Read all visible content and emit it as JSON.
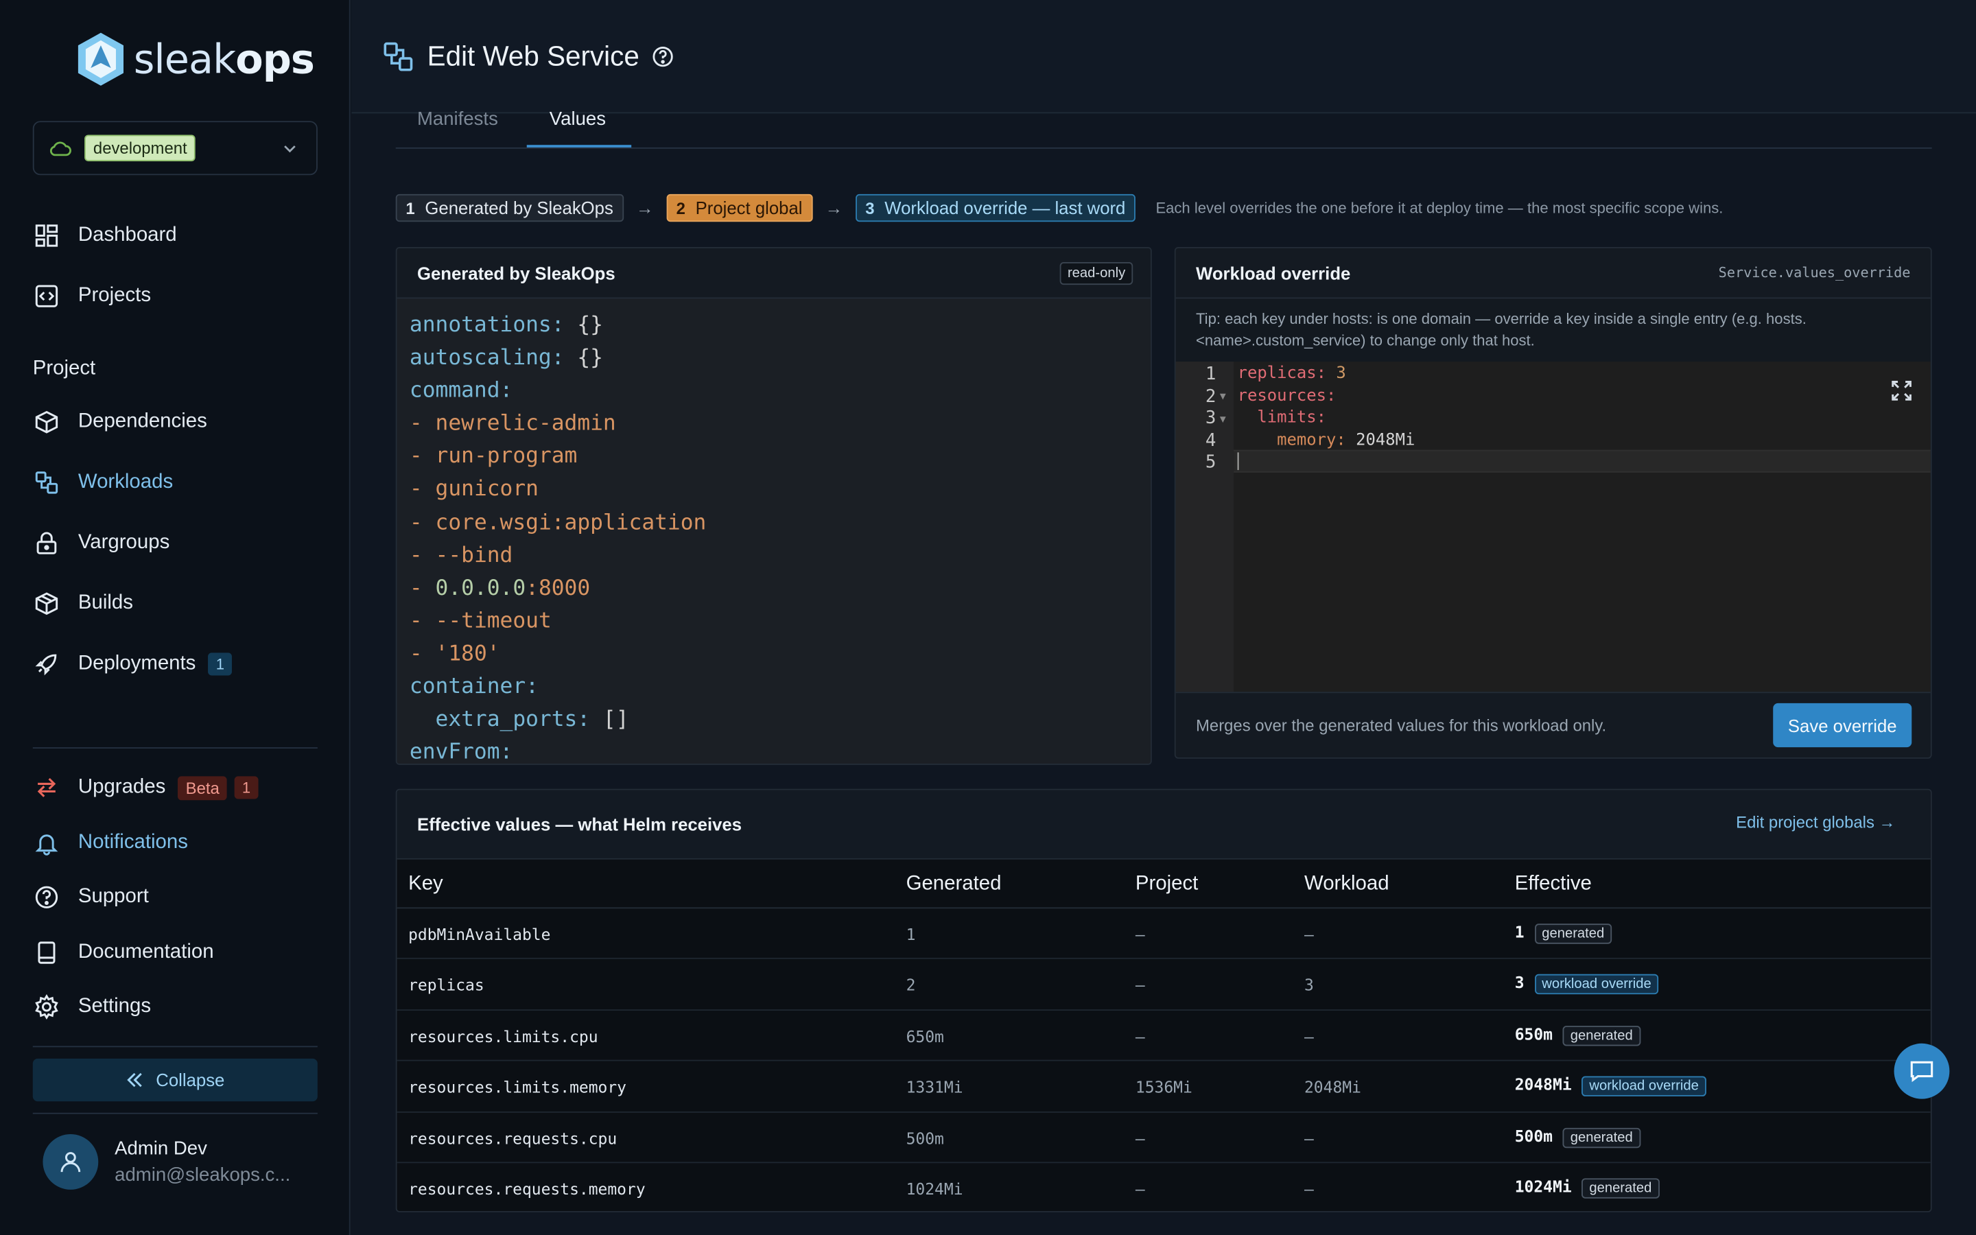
{
  "brand": {
    "name_light": "sleak",
    "name_bold": "ops"
  },
  "environment": {
    "selected": "development"
  },
  "nav": {
    "dashboard": "Dashboard",
    "projects": "Projects",
    "section_project": "Project",
    "dependencies": "Dependencies",
    "workloads": "Workloads",
    "vargroups": "Vargroups",
    "builds": "Builds",
    "deployments": "Deployments",
    "deployments_count": "1",
    "upgrades": "Upgrades",
    "upgrades_beta": "Beta",
    "upgrades_count": "1",
    "notifications": "Notifications",
    "support": "Support",
    "documentation": "Documentation",
    "settings": "Settings",
    "collapse": "Collapse"
  },
  "user": {
    "name": "Admin Dev",
    "email": "admin@sleakops.c..."
  },
  "header": {
    "title": "Edit Web Service"
  },
  "tabs": {
    "manifests": "Manifests",
    "values": "Values"
  },
  "chain": {
    "step1_num": "1",
    "step1": "Generated by SleakOps",
    "step2_num": "2",
    "step2": "Project global",
    "step3_num": "3",
    "step3": "Workload override — last word",
    "note": "Each level overrides the one before it at deploy time — the most specific scope wins."
  },
  "generated_panel": {
    "title": "Generated by SleakOps",
    "badge": "read-only",
    "lines": [
      {
        "k": "annotations:",
        "v": " {}"
      },
      {
        "k": "autoscaling:",
        "v": " {}"
      },
      {
        "k": "command:",
        "v": ""
      },
      {
        "d": "- ",
        "s": "newrelic-admin"
      },
      {
        "d": "- ",
        "s": "run-program"
      },
      {
        "d": "- ",
        "s": "gunicorn"
      },
      {
        "d": "- ",
        "s": "core.wsgi:application"
      },
      {
        "d": "- ",
        "s": "--bind"
      },
      {
        "d": "- ",
        "n": "0.0.0.0",
        "s": ":8000"
      },
      {
        "d": "- ",
        "s": "--timeout"
      },
      {
        "d": "- ",
        "s": "'180'"
      },
      {
        "k": "container:",
        "v": ""
      },
      {
        "k": "  extra_ports:",
        "v": " []"
      },
      {
        "k": "envFrom:",
        "v": ""
      }
    ]
  },
  "override_panel": {
    "title": "Workload override",
    "path": "Service.values_override",
    "tip": "Tip: each key under hosts: is one domain — override a key inside a single entry (e.g. hosts.<name>.custom_service) to change only that host.",
    "editor": {
      "line_numbers": [
        "1",
        "2",
        "3",
        "4",
        "5"
      ],
      "l1_key": "replicas:",
      "l1_val": " 3",
      "l2_key": "resources:",
      "l3_key": "  limits:",
      "l4_key": "    memory:",
      "l4_val": " 2048Mi"
    },
    "footer_note": "Merges over the generated values for this workload only.",
    "save_label": "Save override"
  },
  "effective": {
    "title": "Effective values — what Helm receives",
    "edit_link": "Edit project globals →",
    "columns": {
      "key": "Key",
      "generated": "Generated",
      "project": "Project",
      "workload": "Workload",
      "effective": "Effective"
    },
    "rows": [
      {
        "key": "pdbMinAvailable",
        "generated": "1",
        "project": "—",
        "workload": "—",
        "effective": "1",
        "source": "generated"
      },
      {
        "key": "replicas",
        "generated": "2",
        "project": "—",
        "workload": "3",
        "effective": "3",
        "source": "workload override"
      },
      {
        "key": "resources.limits.cpu",
        "generated": "650m",
        "project": "—",
        "workload": "—",
        "effective": "650m",
        "source": "generated"
      },
      {
        "key": "resources.limits.memory",
        "generated": "1331Mi",
        "project": "1536Mi",
        "workload": "2048Mi",
        "effective": "2048Mi",
        "source": "workload override"
      },
      {
        "key": "resources.requests.cpu",
        "generated": "500m",
        "project": "—",
        "workload": "—",
        "effective": "500m",
        "source": "generated"
      },
      {
        "key": "resources.requests.memory",
        "generated": "1024Mi",
        "project": "—",
        "workload": "—",
        "effective": "1024Mi",
        "source": "generated"
      }
    ]
  },
  "colors": {
    "accent": "#2f86c6",
    "project_global": "#d48a3b",
    "active_nav": "#7fc0ea"
  }
}
